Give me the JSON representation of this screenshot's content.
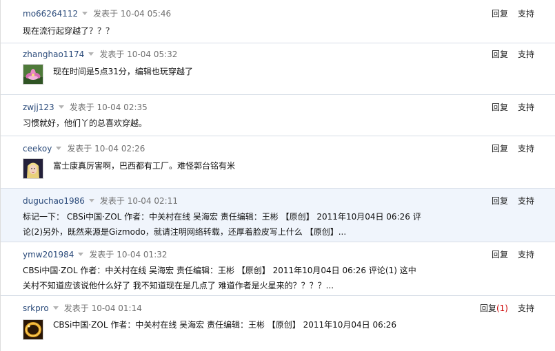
{
  "comments": [
    {
      "user": "mo66264112",
      "posted": "发表于 10-04 05:46",
      "text": "现在流行起穿越了？？？",
      "reply": "回复",
      "support": "支持"
    },
    {
      "user": "zhanghao1174",
      "posted": "发表于 10-04 05:32",
      "text": "现在时间是5点31分，编辑也玩穿越了",
      "reply": "回复",
      "support": "支持",
      "avatar": "lotus-flower-avatar-icon"
    },
    {
      "user": "zwjj123",
      "posted": "发表于 10-04 02:35",
      "text": "习惯就好，他们丫的总喜欢穿越。",
      "reply": "回复",
      "support": "支持"
    },
    {
      "user": "ceekoy",
      "posted": "发表于 10-04 02:26",
      "text": "富士康真厉害啊，巴西都有工厂。难怪郭台铭有米",
      "reply": "回复",
      "support": "支持",
      "avatar": "blonde-girl-avatar-icon"
    },
    {
      "user": "duguchao1986",
      "posted": "发表于 10-04 02:11",
      "text": "标记一下： CBSi中国·ZOL 作者：中关村在线 吴海宏 责任编辑：王彬 【原创】 2011年10月04日 06:26 评论(2)另外，既然来源是Gizmodo，就请注明网络转载，还厚着脸皮写上什么 【原创】...",
      "reply": "回复",
      "support": "支持"
    },
    {
      "user": "ymw201984",
      "posted": "发表于 10-04 01:32",
      "text": "CBSi中国·ZOL 作者：中关村在线 吴海宏 责任编辑：王彬 【原创】 2011年10月04日 06:26 评论(1) 这中关村不知道应该说他什么好了 我不知道现在是几点了 难道作者是火星来的？？？？...",
      "reply": "回复",
      "support": "支持"
    },
    {
      "user": "srkpro",
      "posted": "发表于 10-04 01:14",
      "text": "CBSi中国·ZOL 作者：中关村在线 吴海宏 责任编辑：王彬 【原创】 2011年10月04日 06:26",
      "reply": "回复",
      "reply_count": "(1)",
      "support": "支持",
      "avatar": "gold-ring-avatar-icon"
    }
  ],
  "colors": {
    "username": "#2a4a7a",
    "highlight_row": "#f0f5fc",
    "count": "#cc0000"
  }
}
